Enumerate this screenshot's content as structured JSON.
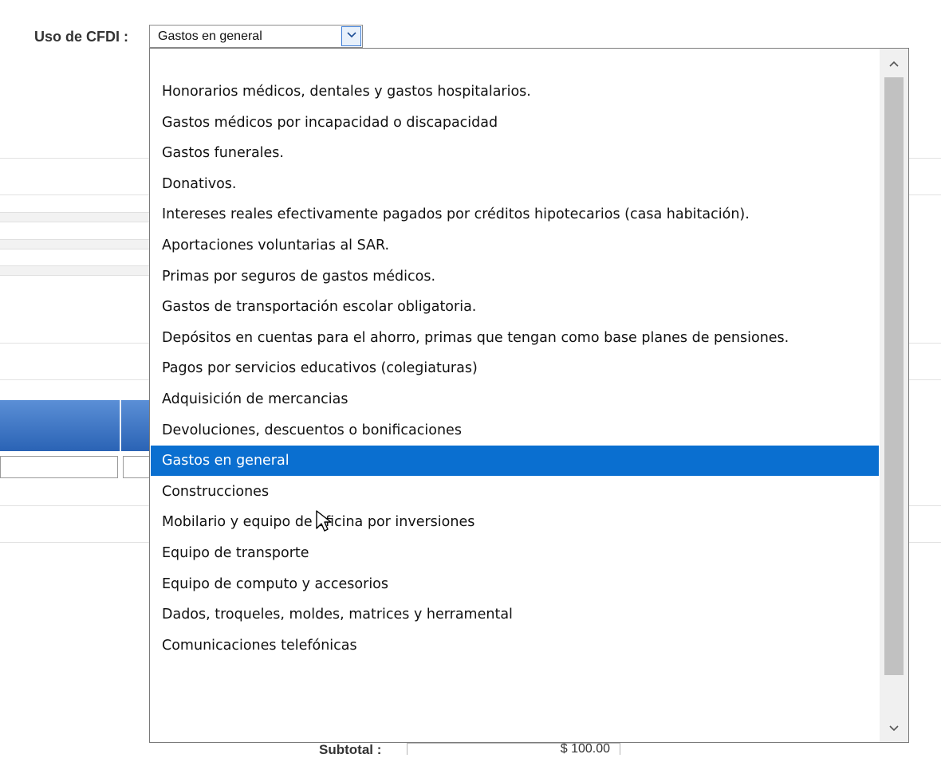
{
  "form": {
    "cfdi_label": "Uso de CFDI :",
    "cfdi_selected_value": "Gastos en general",
    "subtotal_label": "Subtotal :",
    "subtotal_value": "$ 100.00"
  },
  "dropdown": {
    "selected_index": 13,
    "options": [
      "",
      "Honorarios médicos, dentales y gastos hospitalarios.",
      "Gastos médicos por incapacidad o discapacidad",
      "Gastos funerales.",
      "Donativos.",
      "Intereses reales efectivamente pagados por créditos hipotecarios (casa habitación).",
      "Aportaciones voluntarias al SAR.",
      "Primas por seguros de gastos médicos.",
      "Gastos de transportación escolar obligatoria.",
      "Depósitos en cuentas para el ahorro, primas que tengan como base planes de pensiones.",
      "Pagos por servicios educativos (colegiaturas)",
      "Adquisición de mercancias",
      "Devoluciones, descuentos o bonificaciones",
      "Gastos en general",
      "Construcciones",
      "Mobilario y equipo de oficina por inversiones",
      "Equipo de transporte",
      "Equipo de computo y accesorios",
      "Dados, troqueles, moldes, matrices y herramental",
      "Comunicaciones telefónicas"
    ]
  },
  "icons": {
    "select_arrow": "chevron-down-icon",
    "scroll_up": "chevron-up-icon",
    "scroll_down": "chevron-down-icon",
    "cursor": "mouse-pointer-icon"
  },
  "colors": {
    "selected_bg": "#0a6fd0",
    "header_blue": "#2a63b5"
  }
}
